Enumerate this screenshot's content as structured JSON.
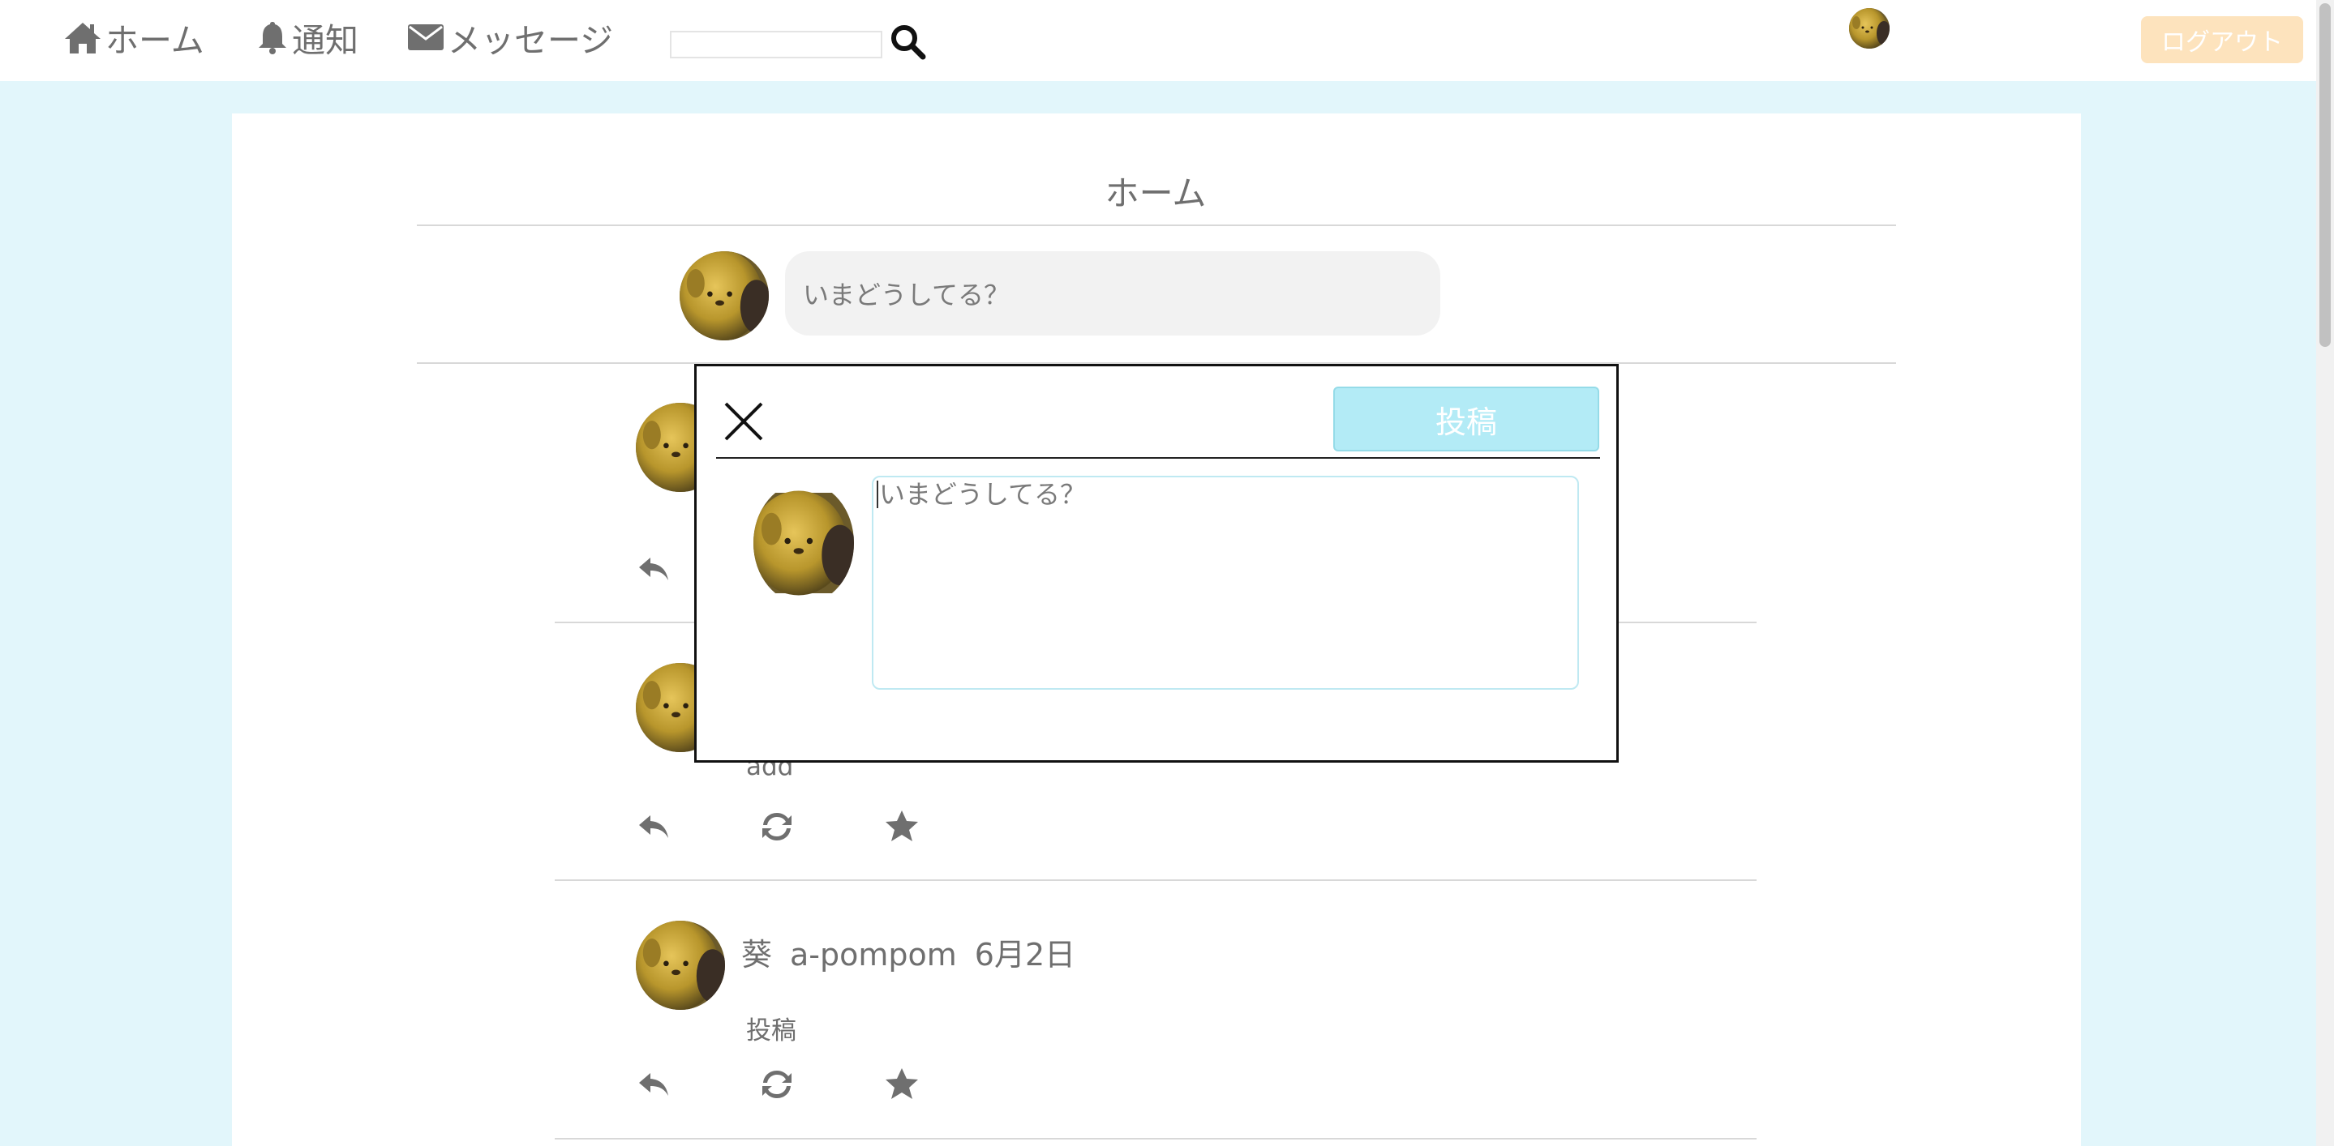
{
  "nav": {
    "home_label": "ホーム",
    "notifications_label": "通知",
    "messages_label": "メッセージ",
    "search_value": "",
    "logout_label": "ログアウト"
  },
  "page": {
    "title": "ホーム"
  },
  "composer": {
    "placeholder": "いまどうしてる？"
  },
  "posts": [
    {
      "name": "",
      "handle": "",
      "date": "",
      "text": ""
    },
    {
      "name": "",
      "handle": "",
      "date": "",
      "text": "add"
    },
    {
      "name": "葵",
      "handle": "a-pompom",
      "date": "6月2日",
      "text": "投稿"
    }
  ],
  "modal": {
    "post_button_label": "投稿",
    "textarea_placeholder": "いまどうしてる？"
  },
  "colors": {
    "page_background": "#e2f6fb",
    "logout_button": "#fde3bd",
    "post_button": "#b3ebf6",
    "text_gray": "#6f6f6f"
  },
  "icons": [
    "home-icon",
    "bell-icon",
    "envelope-icon",
    "search-icon",
    "close-icon",
    "reply-icon",
    "retweet-icon",
    "star-icon"
  ]
}
